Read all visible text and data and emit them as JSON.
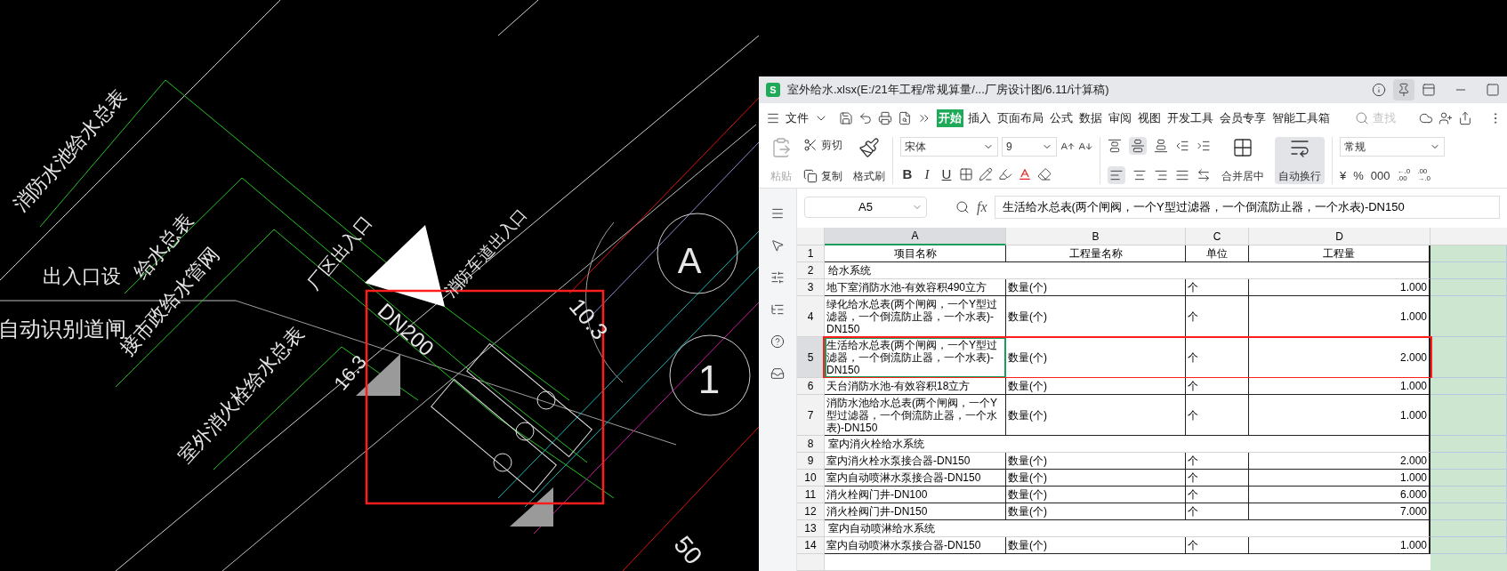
{
  "cad": {
    "labels": [
      "消防水池给水总表",
      "出入口设",
      "给水总表",
      "自动识别道闸",
      "接市政给水管网",
      "室外消火栓给水总表",
      "厂区出入口",
      "消防车道出入口",
      "DN200",
      "16.3",
      "10.3",
      "A",
      "1",
      "50"
    ]
  },
  "window": {
    "logo": "S",
    "title": "室外给水.xlsx(E:/21年工程/常规算量/...厂房设计图/6.11/计算稿)",
    "pinned": true
  },
  "toolbar": {
    "file_menu": "文件",
    "tabs": [
      {
        "label": "开始",
        "selected": true
      },
      {
        "label": "插入",
        "selected": false
      },
      {
        "label": "页面布局",
        "selected": false
      },
      {
        "label": "公式",
        "selected": false
      },
      {
        "label": "数据",
        "selected": false
      },
      {
        "label": "审阅",
        "selected": false
      },
      {
        "label": "视图",
        "selected": false
      },
      {
        "label": "开发工具",
        "selected": false
      },
      {
        "label": "会员专享",
        "selected": false
      },
      {
        "label": "智能工具箱",
        "selected": false
      }
    ],
    "search": {
      "placeholder": "查找"
    }
  },
  "ribbon": {
    "paste": {
      "label": "粘贴",
      "disabled": true
    },
    "cut": "剪切",
    "copy": "复制",
    "format_painter": "格式刷",
    "font": "宋体",
    "font_size": "9",
    "style_buttons": [
      "B",
      "I",
      "U"
    ],
    "merge": "合并居中",
    "wrap": {
      "label": "自动换行",
      "on": true
    },
    "number_format": "常规",
    "number_buttons": [
      "¥",
      "%",
      "000"
    ],
    "decimal_buttons": [
      [
        "←.0",
        ".00"
      ],
      [
        ".00",
        "→.0"
      ]
    ]
  },
  "formula_bar": {
    "name_box": "A5",
    "fx": "fx",
    "value": "生活给水总表(两个闸阀，一个Y型过滤器，一个倒流防止器，一个水表)-DN150"
  },
  "sheet": {
    "columns": [
      {
        "label": "A",
        "selected": true
      },
      {
        "label": "B",
        "selected": false
      },
      {
        "label": "C",
        "selected": false
      },
      {
        "label": "D",
        "selected": false
      }
    ],
    "rows": [
      {
        "number": "1",
        "kind": "header",
        "selected": false,
        "boxed": false,
        "cells": [
          "项目名称",
          "工程量名称",
          "单位",
          "工程量"
        ]
      },
      {
        "number": "2",
        "kind": "section",
        "selected": false,
        "boxed": false,
        "cells": [
          "给水系统"
        ]
      },
      {
        "number": "3",
        "kind": "item",
        "selected": false,
        "boxed": false,
        "cells": [
          "地下室消防水池-有效容积490立方",
          "数量(个)",
          "个",
          "1.000"
        ]
      },
      {
        "number": "4",
        "kind": "item",
        "selected": false,
        "boxed": false,
        "cells": [
          "绿化给水总表(两个闸阀，一个Y型过滤器，一个倒流防止器，一个水表)-DN150",
          "数量(个)",
          "个",
          "1.000"
        ]
      },
      {
        "number": "5",
        "kind": "item",
        "selected": true,
        "boxed": true,
        "cells": [
          "生活给水总表(两个闸阀，一个Y型过滤器，一个倒流防止器，一个水表)-DN150",
          "数量(个)",
          "个",
          "2.000"
        ]
      },
      {
        "number": "6",
        "kind": "item",
        "selected": false,
        "boxed": false,
        "cells": [
          "天台消防水池-有效容积18立方",
          "数量(个)",
          "个",
          "1.000"
        ]
      },
      {
        "number": "7",
        "kind": "item",
        "selected": false,
        "boxed": false,
        "cells": [
          "消防水池给水总表(两个闸阀，一个Y型过滤器，一个倒流防止器，一个水表)-DN150",
          "数量(个)",
          "个",
          "1.000"
        ]
      },
      {
        "number": "8",
        "kind": "section",
        "selected": false,
        "boxed": false,
        "cells": [
          "室内消火栓给水系统"
        ]
      },
      {
        "number": "9",
        "kind": "item",
        "selected": false,
        "boxed": false,
        "cells": [
          "室内消火栓水泵接合器-DN150",
          "数量(个)",
          "个",
          "2.000"
        ]
      },
      {
        "number": "10",
        "kind": "item",
        "selected": false,
        "boxed": false,
        "cells": [
          "室内自动喷淋水泵接合器-DN150",
          "数量(个)",
          "个",
          "1.000"
        ]
      },
      {
        "number": "11",
        "kind": "item",
        "selected": false,
        "boxed": false,
        "cells": [
          "消火栓阀门井-DN100",
          "数量(个)",
          "个",
          "6.000"
        ]
      },
      {
        "number": "12",
        "kind": "item",
        "selected": false,
        "boxed": false,
        "cells": [
          "消火栓阀门井-DN150",
          "数量(个)",
          "个",
          "7.000"
        ]
      },
      {
        "number": "13",
        "kind": "section",
        "selected": false,
        "boxed": false,
        "cells": [
          "室内自动喷淋给水系统"
        ]
      },
      {
        "number": "14",
        "kind": "item",
        "selected": false,
        "boxed": false,
        "cells": [
          "室内自动喷淋水泵接合器-DN150",
          "数量(个)",
          "个",
          "1.000"
        ]
      }
    ]
  }
}
